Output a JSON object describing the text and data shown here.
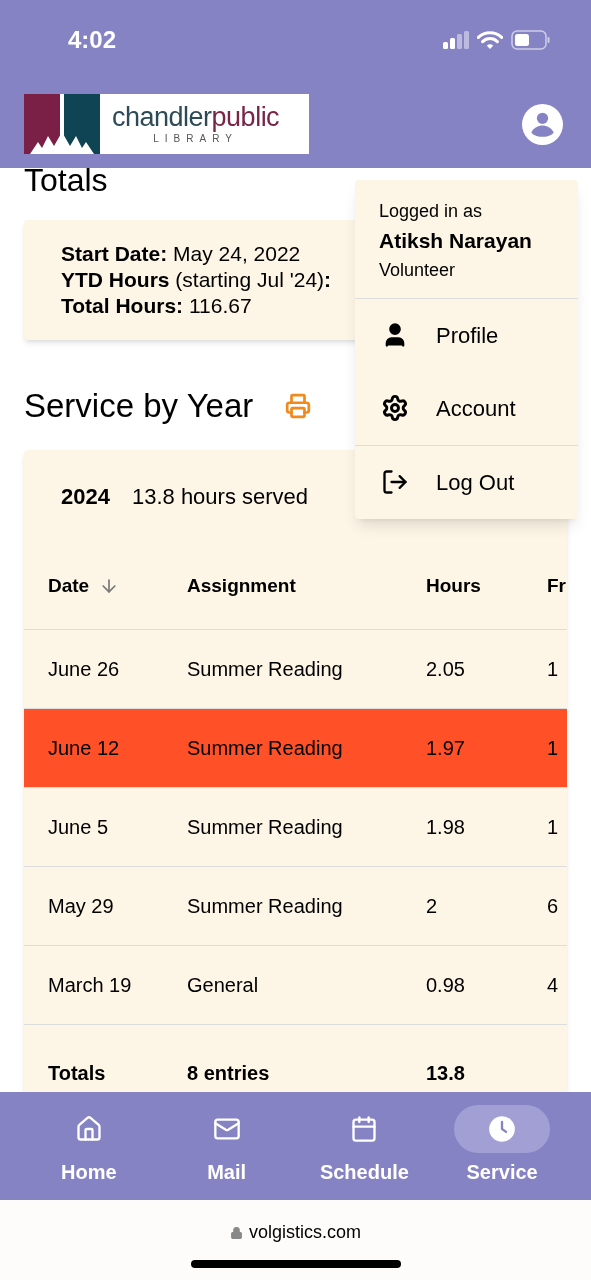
{
  "status_bar": {
    "time": "4:02"
  },
  "header": {
    "logo": {
      "word_1": "chandler",
      "word_2": "public",
      "subtitle": "LIBRARY"
    }
  },
  "totals": {
    "title": "Totals",
    "lines": [
      "**Start Date:** May 24, 2022",
      "**YTD Hours** (starting Jul '24)**:**",
      "**Total Hours:** 116.67"
    ]
  },
  "service": {
    "title": "Service by Year",
    "year": "2024",
    "summary": "13.8 hours served",
    "columns": [
      {
        "label": "Date",
        "sorted": true
      },
      {
        "label": "Assignment",
        "sorted": false
      },
      {
        "label": "Hours",
        "sorted": false
      },
      {
        "label": "Fr",
        "sorted": false
      }
    ],
    "rows": [
      {
        "cells": [
          "June 26",
          "Summer Reading",
          "2.05",
          "1"
        ],
        "highlighted": false
      },
      {
        "cells": [
          "June 12",
          "Summer Reading",
          "1.97",
          "1"
        ],
        "highlighted": true
      },
      {
        "cells": [
          "June 5",
          "Summer Reading",
          "1.98",
          "1"
        ],
        "highlighted": false
      },
      {
        "cells": [
          "May 29",
          "Summer Reading",
          "2",
          "6"
        ],
        "highlighted": false
      },
      {
        "cells": [
          "March 19",
          "General",
          "0.98",
          "4"
        ],
        "highlighted": false
      }
    ],
    "totals_row": [
      "Totals",
      "8 entries",
      "13.8"
    ]
  },
  "user_menu": {
    "caption": "Logged in as",
    "name": "Atiksh Narayan",
    "role": "Volunteer",
    "items": [
      {
        "kind": "profile",
        "label": "Profile"
      },
      {
        "kind": "account",
        "label": "Account"
      },
      {
        "kind": "logout",
        "label": "Log Out"
      }
    ]
  },
  "bottom_nav": [
    {
      "kind": "home",
      "label": "Home",
      "selected": false
    },
    {
      "kind": "mail",
      "label": "Mail",
      "selected": false
    },
    {
      "kind": "schedule",
      "label": "Schedule",
      "selected": false
    },
    {
      "kind": "service",
      "label": "Service",
      "selected": true
    }
  ],
  "browser": {
    "url": "volgistics.com"
  }
}
